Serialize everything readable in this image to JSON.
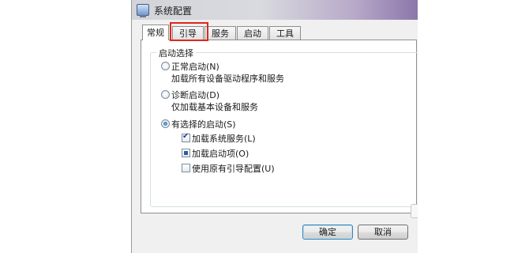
{
  "window": {
    "title": "系统配置"
  },
  "tabs": [
    {
      "label": "常规"
    },
    {
      "label": "引导"
    },
    {
      "label": "服务"
    },
    {
      "label": "启动"
    },
    {
      "label": "工具"
    }
  ],
  "startup_group": {
    "label": "启动选择",
    "normal": {
      "label": "正常启动(N)",
      "description": "加载所有设备驱动程序和服务"
    },
    "diagnostic": {
      "label": "诊断启动(D)",
      "description": "仅加载基本设备和服务"
    },
    "selective": {
      "label": "有选择的启动(S)",
      "options": [
        {
          "label": "加载系统服务(L)",
          "state": "checked"
        },
        {
          "label": "加载启动项(O)",
          "state": "indeterminate"
        },
        {
          "label": "使用原有引导配置(U)",
          "state": "unchecked"
        }
      ]
    },
    "selected": "selective"
  },
  "buttons": {
    "ok": "确定",
    "cancel": "取消"
  },
  "colors": {
    "highlight": "#e1261c",
    "title_accent": "#8c76ab"
  }
}
